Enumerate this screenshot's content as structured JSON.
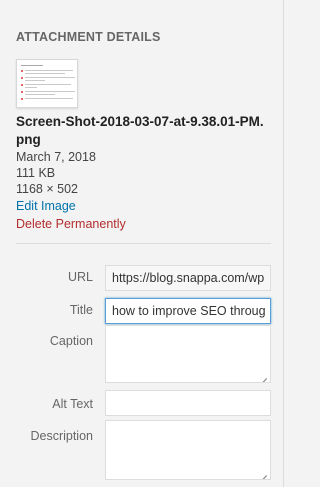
{
  "heading": "ATTACHMENT DETAILS",
  "file": {
    "name": "Screen-Shot-2018-03-07-at-9.38.01-PM.png",
    "date": "March 7, 2018",
    "size": "111 KB",
    "dimensions": "1168 × 502"
  },
  "actions": {
    "edit": "Edit Image",
    "delete": "Delete Permanently"
  },
  "fields": {
    "url": {
      "label": "URL",
      "value": "https://blog.snappa.com/wp"
    },
    "title": {
      "label": "Title",
      "value": "how to improve SEO throug"
    },
    "caption": {
      "label": "Caption",
      "value": ""
    },
    "alt": {
      "label": "Alt Text",
      "value": ""
    },
    "description": {
      "label": "Description",
      "value": ""
    }
  },
  "colors": {
    "link": "#0073aa",
    "delete": "#b32d2e",
    "focus": "#5b9dd9"
  }
}
